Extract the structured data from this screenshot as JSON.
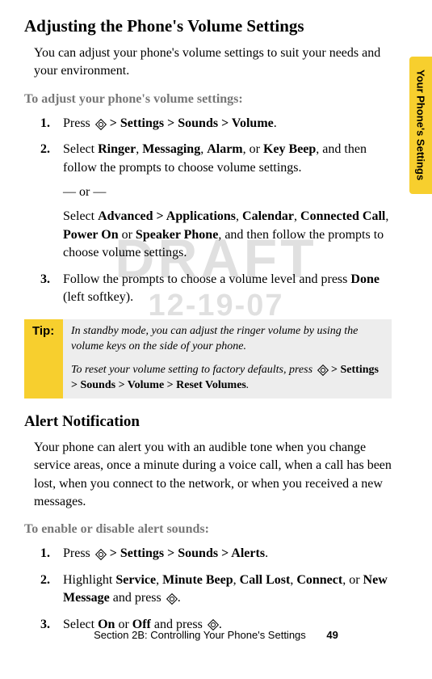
{
  "watermark": {
    "main": "DRAFT",
    "sub": "12-19-07"
  },
  "side_tab": "Your Phone's Settings",
  "h1": "Adjusting the Phone's Volume Settings",
  "intro": "You can adjust your phone's volume settings to suit your needs and your environment.",
  "subheading1": "To adjust your phone's volume settings:",
  "step1": {
    "num": "1.",
    "pre": "Press ",
    "bold": " > Settings > Sounds > Volume",
    "post": "."
  },
  "step2": {
    "num": "2.",
    "pre": "Select ",
    "b1": "Ringer",
    "c1": ", ",
    "b2": "Messaging",
    "c2": ", ",
    "b3": "Alarm",
    "c3": ", or ",
    "b4": "Key Beep",
    "post": ", and then follow the prompts to choose volume settings.",
    "or": "— or —",
    "alt_pre": "Select ",
    "ab1": "Advanced > Applications",
    "ac1": ", ",
    "ab2": "Calendar",
    "ac2": ", ",
    "ab3": "Connected Call",
    "ac3": ", ",
    "ab4": "Power On",
    "ac4": " or ",
    "ab5": "Speaker Phone",
    "alt_post": ", and then follow the prompts to choose volume settings."
  },
  "step3": {
    "num": "3.",
    "pre": "Follow the prompts to choose a volume level and press ",
    "b1": "Done",
    "post": " (left softkey)."
  },
  "tip": {
    "label": "Tip:",
    "p1": "In standby mode, you can adjust the ringer volume by using the volume keys on the side of your phone.",
    "p2_pre": "To reset your volume setting to factory defaults, press ",
    "p2_bold": " > Settings > Sounds > Volume > Reset Volumes",
    "p2_post": "."
  },
  "h2": "Alert Notification",
  "alert_intro": "Your phone can alert you with an audible tone when you change service areas, once a minute during a voice call, when a call has been lost, when you connect to the network, or when you received a new messages.",
  "subheading2": "To enable or disable alert sounds:",
  "astep1": {
    "num": "1.",
    "pre": "Press ",
    "bold": " > Settings > Sounds > Alerts",
    "post": "."
  },
  "astep2": {
    "num": "2.",
    "pre": "Highlight ",
    "b1": "Service",
    "c1": ", ",
    "b2": "Minute Beep",
    "c2": ", ",
    "b3": "Call Lost",
    "c3": ", ",
    "b4": "Connect",
    "c4": ", or ",
    "b5": "New Message",
    "mid": " and press ",
    "post": "."
  },
  "astep3": {
    "num": "3.",
    "pre": "Select ",
    "b1": "On",
    "c1": " or ",
    "b2": "Off",
    "mid": " and press ",
    "post": "."
  },
  "footer": {
    "text": "Section 2B: Controlling Your Phone's Settings",
    "page": "49"
  }
}
